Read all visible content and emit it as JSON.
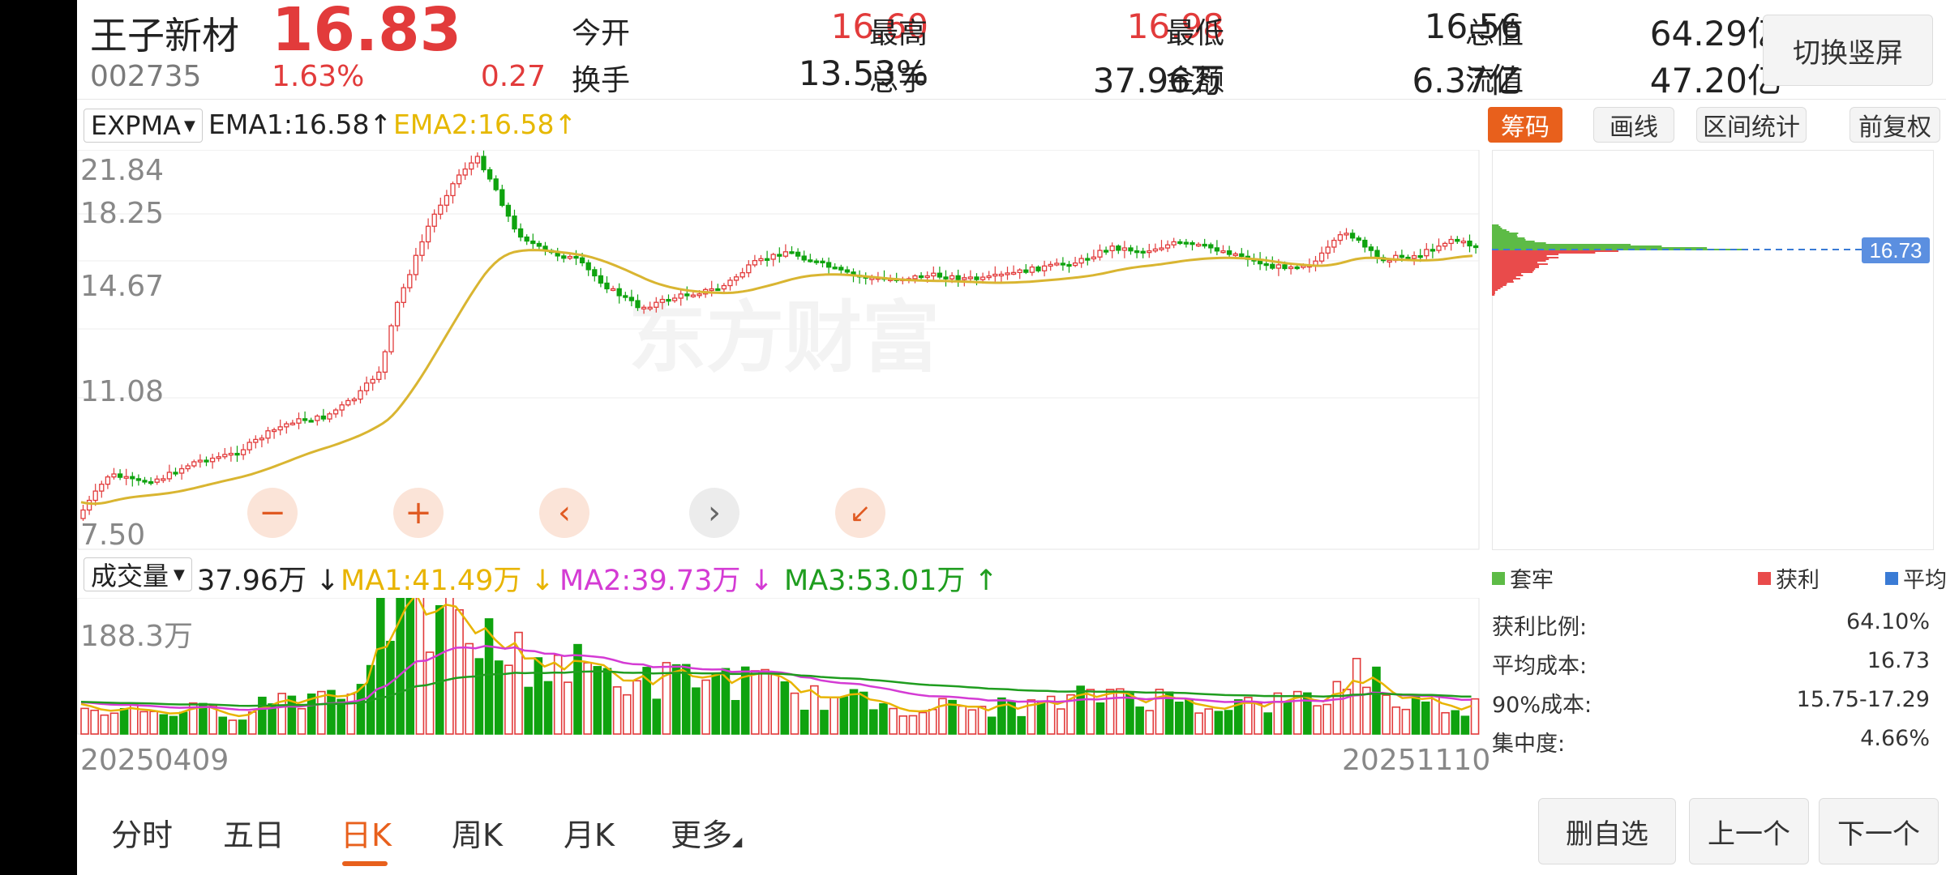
{
  "stock": {
    "name": "王子新材",
    "price": "16.83",
    "code": "002735",
    "change_pct": "1.63%",
    "change_amt": "0.27"
  },
  "quote": {
    "open_label": "今开",
    "open": "16.60",
    "high_label": "最高",
    "high": "16.98",
    "low_label": "最低",
    "low": "16.56",
    "mcap_label": "总值",
    "mcap": "64.29亿",
    "turnover_label": "换手",
    "turnover": "13.53%",
    "vol_label": "总手",
    "vol": "37.96万",
    "amount_label": "金额",
    "amount": "6.37亿",
    "float_label": "流值",
    "float": "47.20亿"
  },
  "switch_button": "切换竖屏",
  "indicator": {
    "selector": "EXPMA",
    "ema1": "EMA1:16.58",
    "ema2": "EMA2:16.58",
    "ema1_arrow": "↑",
    "ema2_arrow": "↑"
  },
  "right_tabs": [
    "筹码",
    "画线",
    "区间统计",
    "前复权"
  ],
  "price_axis": [
    "21.84",
    "18.25",
    "14.67",
    "11.08",
    "7.50"
  ],
  "watermark": "东方财富",
  "chart_controls": {
    "zoom_out": "−",
    "zoom_in": "+",
    "prev": "‹",
    "next": "›",
    "collapse": "↙"
  },
  "volume": {
    "selector": "成交量",
    "value": "37.96万",
    "value_arrow": "↓",
    "ma1": "MA1:41.49万",
    "ma1_arrow": "↓",
    "ma2": "MA2:39.73万",
    "ma2_arrow": "↓",
    "ma3": "MA3:53.01万",
    "ma3_arrow": "↑",
    "axis_max": "188.3万"
  },
  "dates": {
    "start": "20250409",
    "end": "20251110"
  },
  "chips": {
    "price_tag": "16.73",
    "legend": [
      "套牢",
      "获利",
      "平均"
    ],
    "stats": [
      {
        "label": "获利比例:",
        "value": "64.10%"
      },
      {
        "label": "平均成本:",
        "value": "16.73"
      },
      {
        "label": "90%成本:",
        "value": "15.75-17.29"
      },
      {
        "label": "集中度:",
        "value": "4.66%"
      }
    ]
  },
  "bottom_tabs": [
    "分时",
    "五日",
    "日K",
    "周K",
    "月K",
    "更多"
  ],
  "bottom_buttons": [
    "删自选",
    "上一个",
    "下一个"
  ],
  "colors": {
    "up": "#e23b3b",
    "down": "#0fa30f",
    "ema1": "#333333",
    "ema2": "#d9b531",
    "ma1": "#e8b400",
    "ma2": "#d43bd4",
    "ma3": "#1f9d1f",
    "accent": "#e8601c"
  }
}
